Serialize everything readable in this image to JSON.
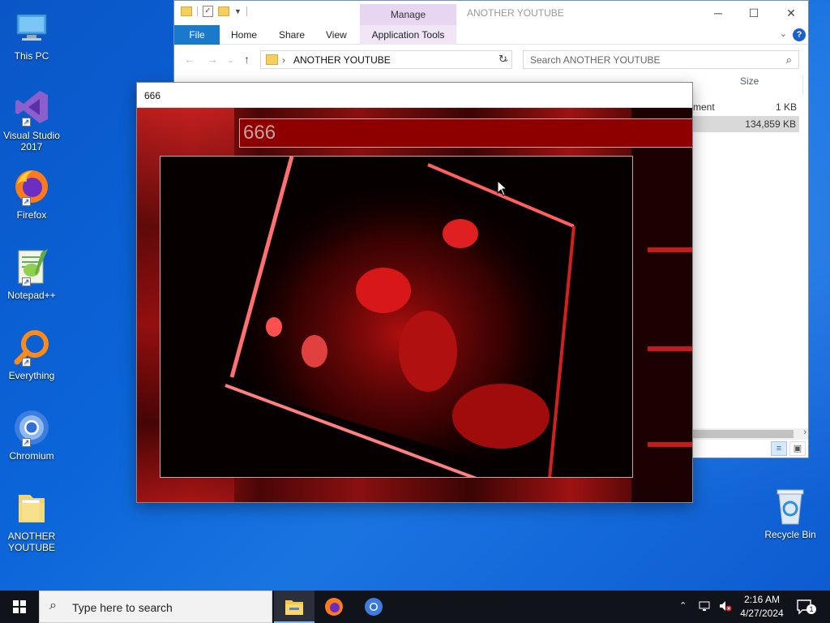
{
  "desktop": {
    "icons": [
      {
        "label": "This PC"
      },
      {
        "label": "Visual Studio 2017"
      },
      {
        "label": "Firefox"
      },
      {
        "label": "Notepad++"
      },
      {
        "label": "Everything"
      },
      {
        "label": "Chromium"
      },
      {
        "label": "ANOTHER YOUTUBE"
      }
    ],
    "recycle_bin": "Recycle Bin"
  },
  "explorer": {
    "manage_tab": "Manage",
    "window_title": "ANOTHER YOUTUBE",
    "ribbon_tabs": [
      "File",
      "Home",
      "Share",
      "View",
      "Application Tools"
    ],
    "address_path": "ANOTHER YOUTUBE",
    "search_placeholder": "Search ANOTHER YOUTUBE",
    "columns": {
      "size": "Size"
    },
    "files": [
      {
        "type_fragment": "ment",
        "size": "1 KB"
      },
      {
        "type_fragment": "",
        "size": "134,859 KB"
      }
    ]
  },
  "app": {
    "window_title": "666",
    "header_text": "666"
  },
  "taskbar": {
    "search_placeholder": "Type here to search",
    "time": "2:16 AM",
    "date": "4/27/2024",
    "notification_count": "1"
  }
}
